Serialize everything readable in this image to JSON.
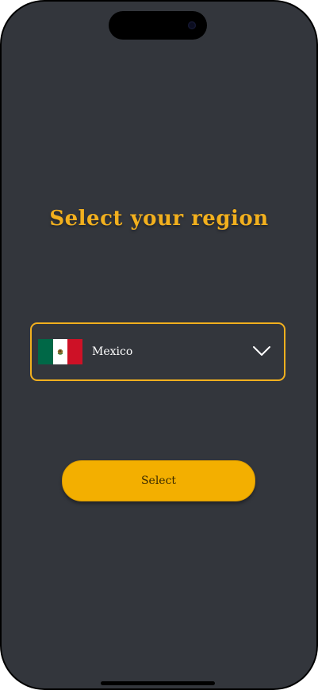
{
  "page": {
    "title": "Select your region"
  },
  "region_selector": {
    "selected_country": "Mexico",
    "flag_icon": "mexico-flag-icon",
    "expand_icon": "chevron-down-icon"
  },
  "actions": {
    "select_label": "Select"
  },
  "colors": {
    "background": "#33363c",
    "accent": "#f2b01e",
    "button": "#f3af00",
    "text": "#ffffff"
  }
}
